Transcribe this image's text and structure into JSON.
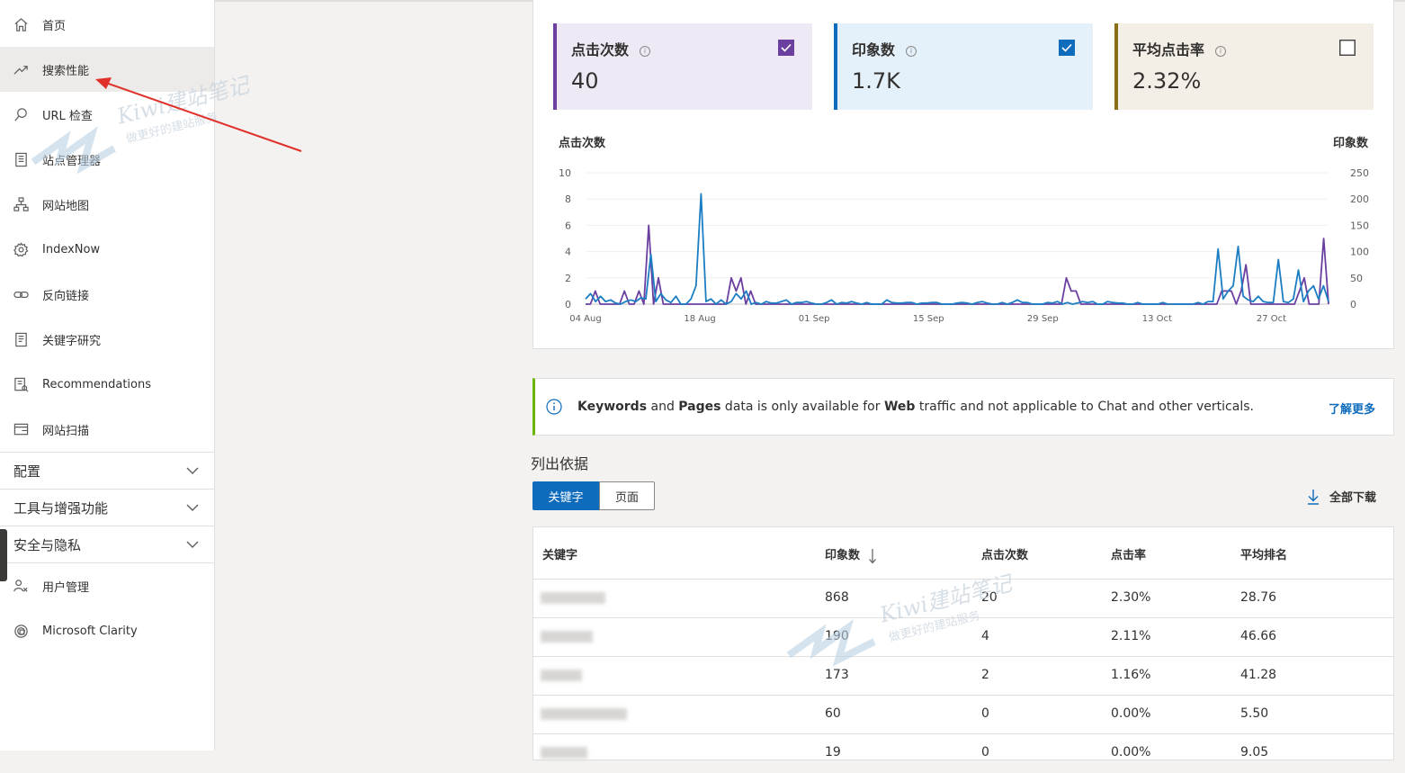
{
  "sidebar": {
    "items": [
      {
        "label": "首页",
        "icon": "home-icon"
      },
      {
        "label": "搜索性能",
        "icon": "trend-icon"
      },
      {
        "label": "URL 检查",
        "icon": "search-icon"
      },
      {
        "label": "站点管理器",
        "icon": "document-icon"
      },
      {
        "label": "网站地图",
        "icon": "sitemap-icon"
      },
      {
        "label": "IndexNow",
        "icon": "gear-icon"
      },
      {
        "label": "反向链接",
        "icon": "link-icon"
      },
      {
        "label": "关键字研究",
        "icon": "list-document-icon"
      },
      {
        "label": "Recommendations",
        "icon": "recommendations-icon"
      },
      {
        "label": "网站扫描",
        "icon": "scan-icon"
      }
    ],
    "groups": [
      "配置",
      "工具与增强功能",
      "安全与隐私"
    ],
    "bottom_items": [
      {
        "label": "用户管理",
        "icon": "users-icon"
      },
      {
        "label": "Microsoft Clarity",
        "icon": "clarity-icon"
      }
    ]
  },
  "metrics": [
    {
      "label": "点击次数",
      "value": "40",
      "checked": true,
      "color": "#6b3fa0",
      "bg": "#efe9f6",
      "info": "i"
    },
    {
      "label": "印象数",
      "value": "1.7K",
      "checked": true,
      "color": "#0f6cbd",
      "bg": "#e4f1fb",
      "info": "i"
    },
    {
      "label": "平均点击率",
      "value": "2.32%",
      "checked": false,
      "color": "#8a6d16",
      "bg": "#f4efe6",
      "info": "i"
    }
  ],
  "chart_data": {
    "type": "line",
    "ylabel": "点击次数",
    "y2label": "印象数",
    "ylim": [
      0,
      10
    ],
    "y2lim": [
      0,
      250
    ],
    "yticks": [
      "10",
      "8",
      "6",
      "4",
      "2",
      "0"
    ],
    "y2ticks": [
      "250",
      "200",
      "150",
      "100",
      "50",
      "0"
    ],
    "xticks": [
      "04 Aug",
      "18 Aug",
      "01 Sep",
      "15 Sep",
      "29 Sep",
      "13 Oct",
      "27 Oct"
    ],
    "grid": true,
    "series": [
      {
        "color": "#6b3fa0",
        "values": [
          0,
          0,
          1,
          0,
          0,
          0,
          0,
          0,
          1,
          0,
          0,
          1,
          0,
          6,
          0,
          2,
          0,
          0,
          0,
          0,
          0,
          0,
          0,
          0,
          0,
          0,
          0,
          0,
          0,
          0,
          2,
          1,
          2,
          0,
          1,
          0,
          0,
          0,
          0,
          0,
          0,
          0,
          0,
          0,
          0,
          0,
          0,
          0,
          0,
          0,
          0,
          0,
          0,
          0,
          0,
          0,
          0,
          0,
          0,
          0,
          0,
          0,
          0,
          0,
          0,
          0,
          0,
          0,
          0,
          0,
          0,
          0,
          0,
          0,
          0,
          0,
          0,
          0,
          0,
          0,
          0,
          0,
          0,
          0,
          0,
          0,
          0,
          0,
          0,
          0,
          0,
          0,
          0,
          0,
          0,
          0,
          0,
          0,
          0,
          2,
          1,
          1,
          0,
          0,
          0,
          0,
          0,
          0,
          0,
          0,
          0,
          0,
          0,
          0,
          0,
          0,
          0,
          0,
          0,
          0,
          0,
          0,
          0,
          0,
          0,
          0,
          0,
          0,
          0,
          0,
          0,
          1,
          1,
          1,
          0,
          1,
          3,
          0,
          0,
          0,
          0,
          0,
          0,
          0,
          0,
          0,
          0,
          1,
          2,
          0,
          0,
          0,
          5,
          0
        ]
      },
      {
        "color": "#1b7ec2",
        "values": [
          10,
          20,
          5,
          15,
          5,
          8,
          2,
          0,
          5,
          8,
          5,
          12,
          10,
          95,
          5,
          20,
          8,
          3,
          15,
          0,
          0,
          10,
          35,
          210,
          5,
          10,
          0,
          8,
          0,
          5,
          20,
          10,
          25,
          0,
          3,
          0,
          5,
          2,
          2,
          5,
          8,
          0,
          3,
          3,
          5,
          2,
          0,
          0,
          3,
          8,
          0,
          3,
          2,
          5,
          2,
          0,
          3,
          0,
          0,
          0,
          8,
          3,
          2,
          2,
          3,
          3,
          0,
          2,
          2,
          3,
          3,
          0,
          0,
          0,
          2,
          3,
          2,
          0,
          3,
          5,
          2,
          0,
          0,
          3,
          0,
          3,
          8,
          3,
          3,
          0,
          0,
          0,
          3,
          2,
          5,
          0,
          3,
          0,
          2,
          5,
          3,
          5,
          0,
          0,
          5,
          3,
          2,
          2,
          0,
          0,
          3,
          0,
          0,
          0,
          0,
          3,
          0,
          0,
          0,
          0,
          0,
          0,
          3,
          0,
          5,
          5,
          105,
          10,
          25,
          35,
          110,
          15,
          8,
          5,
          15,
          5,
          3,
          3,
          85,
          5,
          3,
          10,
          65,
          5,
          25,
          35,
          10,
          35,
          5
        ]
      }
    ]
  },
  "banner": {
    "text_parts": [
      {
        "t": "Keywords",
        "b": true
      },
      {
        "t": " and ",
        "b": false
      },
      {
        "t": "Pages",
        "b": true
      },
      {
        "t": " data is only available for ",
        "b": false
      },
      {
        "t": "Web",
        "b": true
      },
      {
        "t": " traffic and not applicable to Chat and other verticals.",
        "b": false
      }
    ],
    "link": "了解更多"
  },
  "list": {
    "title": "列出依据",
    "tabs": [
      "关键字",
      "页面"
    ],
    "download": "全部下载",
    "columns": [
      "关键字",
      "印象数",
      "点击次数",
      "点击率",
      "平均排名"
    ],
    "rows": [
      {
        "impressions": "868",
        "clicks": "20",
        "ctr": "2.30%",
        "rank": "28.76",
        "blur_w": 72
      },
      {
        "impressions": "190",
        "clicks": "4",
        "ctr": "2.11%",
        "rank": "46.66",
        "blur_w": 58
      },
      {
        "impressions": "173",
        "clicks": "2",
        "ctr": "1.16%",
        "rank": "41.28",
        "blur_w": 46
      },
      {
        "impressions": "60",
        "clicks": "0",
        "ctr": "0.00%",
        "rank": "5.50",
        "blur_w": 96
      },
      {
        "impressions": "19",
        "clicks": "0",
        "ctr": "0.00%",
        "rank": "9.05",
        "blur_w": 52
      }
    ]
  },
  "watermark": {
    "brand": "Kiwi建站笔记",
    "tagline": "做更好的建站服务"
  }
}
